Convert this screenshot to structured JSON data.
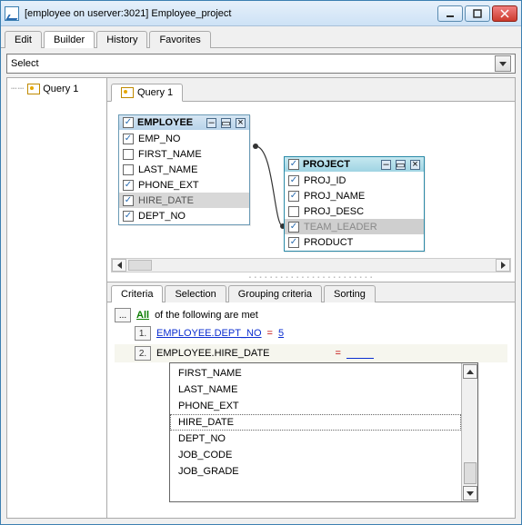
{
  "window": {
    "title": "[employee on userver:3021] Employee_project"
  },
  "main_tabs": [
    "Edit",
    "Builder",
    "History",
    "Favorites"
  ],
  "main_tab_active": 1,
  "select_bar": {
    "text": "Select"
  },
  "tree": {
    "items": [
      "Query 1"
    ]
  },
  "query_tabs": [
    "Query 1"
  ],
  "tables": {
    "employee": {
      "title": "EMPLOYEE",
      "header_checked": true,
      "fields": [
        {
          "name": "EMP_NO",
          "checked": true
        },
        {
          "name": "FIRST_NAME",
          "checked": false
        },
        {
          "name": "LAST_NAME",
          "checked": false
        },
        {
          "name": "PHONE_EXT",
          "checked": true
        },
        {
          "name": "HIRE_DATE",
          "checked": true,
          "selected": true
        },
        {
          "name": "DEPT_NO",
          "checked": true
        }
      ]
    },
    "project": {
      "title": "PROJECT",
      "header_checked": true,
      "fields": [
        {
          "name": "PROJ_ID",
          "checked": true
        },
        {
          "name": "PROJ_NAME",
          "checked": true
        },
        {
          "name": "PROJ_DESC",
          "checked": false
        },
        {
          "name": "TEAM_LEADER",
          "checked": true,
          "selected": true
        },
        {
          "name": "PRODUCT",
          "checked": true
        }
      ]
    }
  },
  "criteria_tabs": [
    "Criteria",
    "Selection",
    "Grouping criteria",
    "Sorting"
  ],
  "criteria_tab_active": 0,
  "criteria": {
    "header_all": "All",
    "header_rest": "of the following are met",
    "rows": [
      {
        "n": "1.",
        "field": "EMPLOYEE.DEPT_NO",
        "op": "=",
        "value": "5"
      },
      {
        "n": "2.",
        "field": "EMPLOYEE.HIRE_DATE",
        "op": "=",
        "value": ""
      }
    ]
  },
  "dropdown": {
    "items": [
      "FIRST_NAME",
      "LAST_NAME",
      "PHONE_EXT",
      "HIRE_DATE",
      "DEPT_NO",
      "JOB_CODE",
      "JOB_GRADE"
    ],
    "highlight_index": 3
  },
  "ellipsis": "..."
}
